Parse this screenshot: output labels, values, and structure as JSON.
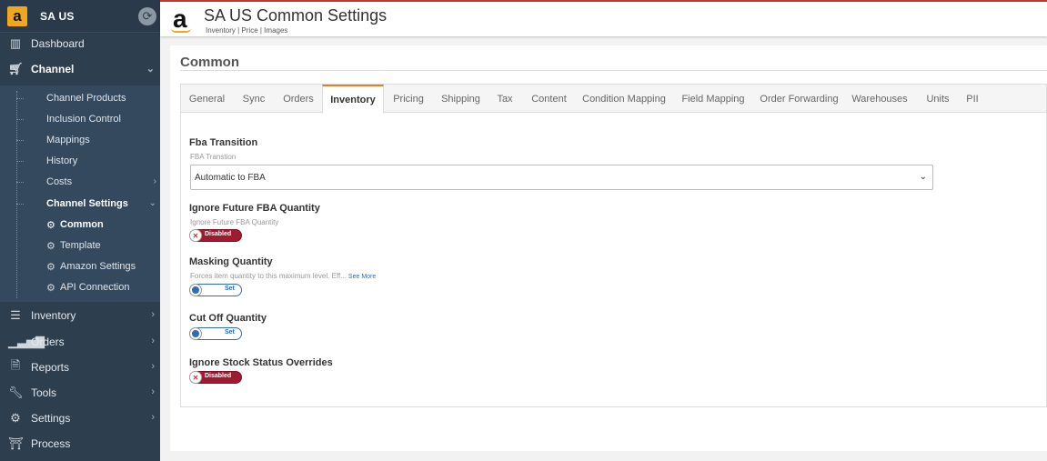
{
  "sidebar": {
    "brand": {
      "logo": "a",
      "name": "SA US"
    },
    "nav": {
      "dashboard": "Dashboard",
      "channel": "Channel",
      "inventory": "Inventory",
      "orders": "Orders",
      "reports": "Reports",
      "tools": "Tools",
      "settings": "Settings",
      "process": "Process"
    },
    "channel_sub": {
      "channel_products": "Channel Products",
      "inclusion_control": "Inclusion Control",
      "mappings": "Mappings",
      "history": "History",
      "costs": "Costs",
      "channel_settings": "Channel Settings"
    },
    "channel_settings_sub": {
      "common": "Common",
      "template": "Template",
      "amazon_settings": "Amazon Settings",
      "api_connection": "API Connection"
    }
  },
  "header": {
    "logo": "a",
    "title": "SA US Common Settings",
    "subtitle": "Inventory | Price | Images"
  },
  "main": {
    "title": "Common",
    "tabs": {
      "general": "General",
      "sync": "Sync",
      "orders": "Orders",
      "inventory": "Inventory",
      "pricing": "Pricing",
      "shipping": "Shipping",
      "tax": "Tax",
      "content": "Content",
      "condition_mapping": "Condition Mapping",
      "field_mapping": "Field Mapping",
      "order_forwarding": "Order Forwarding",
      "warehouses": "Warehouses",
      "units": "Units",
      "pii": "PII"
    },
    "active_tab": "Inventory",
    "fields": {
      "fba_transition": {
        "label": "Fba Transition",
        "help": "FBA Transtion",
        "value": "Automatic to FBA"
      },
      "ignore_future": {
        "label": "Ignore Future FBA Quantity",
        "help": "Ignore Future FBA Quantity",
        "state": "Disabled"
      },
      "masking": {
        "label": "Masking Quantity",
        "help": "Forces item quantity to this maximum level. Eff...",
        "see_more": "See More",
        "state": "Set"
      },
      "cutoff": {
        "label": "Cut Off Quantity",
        "state": "Set"
      },
      "ignore_stock": {
        "label": "Ignore Stock Status Overrides",
        "state": "Disabled"
      }
    }
  },
  "colors": {
    "sidebar": "#2d3e4f",
    "accent": "#e67e22",
    "disabled_toggle": "#9e1b32",
    "set_toggle": "#2f6db5"
  }
}
